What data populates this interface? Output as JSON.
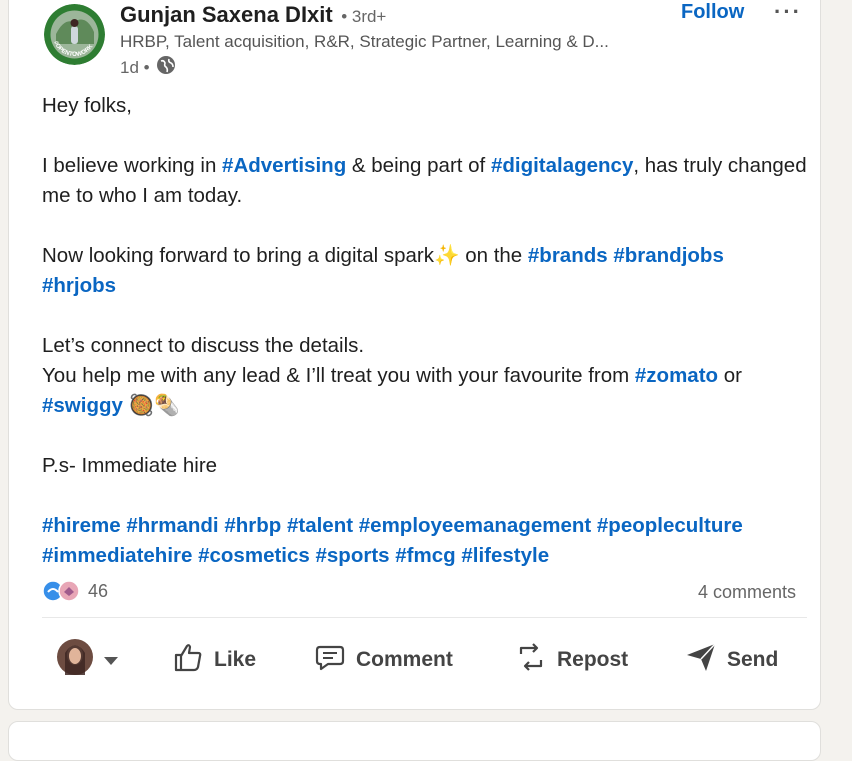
{
  "post": {
    "author": {
      "name": "Gunjan Saxena DIxit",
      "degree": "• 3rd+",
      "headline": "HRBP, Talent acquisition, R&R, Strategic Partner, Learning & D...",
      "time": "1d •",
      "avatar_text": "#OPENTOWORK"
    },
    "follow_label": "Follow",
    "more_label": "···",
    "content": {
      "greeting": "Hey folks,",
      "p1_a": "I believe working in ",
      "p1_tag1": "#Advertising",
      "p1_b": " & being part of ",
      "p1_tag2": "#digitalagency",
      "p1_c": ", has truly changed me to who I am today.",
      "p2_a": "Now looking forward to bring a digital spark",
      "p2_emoji": "✨",
      "p2_b": " on the ",
      "p2_tag1": "#brands",
      "p2_tag2": "#brandjobs",
      "p2_tag3": "#hrjobs",
      "p3_line1": "Let’s connect to discuss the details.",
      "p3_a": "You help me with any lead & I’ll treat you with your favourite from ",
      "p3_tag1": "#zomato",
      "p3_b": " or ",
      "p3_tag2": "#swiggy",
      "p3_emoji": " 🥘🌯",
      "p4": "P.s- Immediate hire",
      "hashtags": [
        "#hireme",
        "#hrmandi",
        "#hrbp",
        "#talent",
        "#employeemanagement",
        "#peopleculture",
        "#immediatehire",
        "#cosmetics",
        "#sports",
        "#fmcg",
        "#lifestyle"
      ]
    },
    "reactions_count": "46",
    "comments_label": "4 comments",
    "actions": {
      "like": "Like",
      "comment": "Comment",
      "repost": "Repost",
      "send": "Send"
    },
    "icons": {
      "globe": "globe-icon",
      "like": "thumbs-up-icon",
      "comment": "comment-bubble-icon",
      "repost": "repost-arrows-icon",
      "send": "paper-plane-icon",
      "dropdown": "caret-down-icon"
    },
    "colors": {
      "accent": "#0a66c2",
      "open_to_work": "#2e7d32"
    }
  }
}
